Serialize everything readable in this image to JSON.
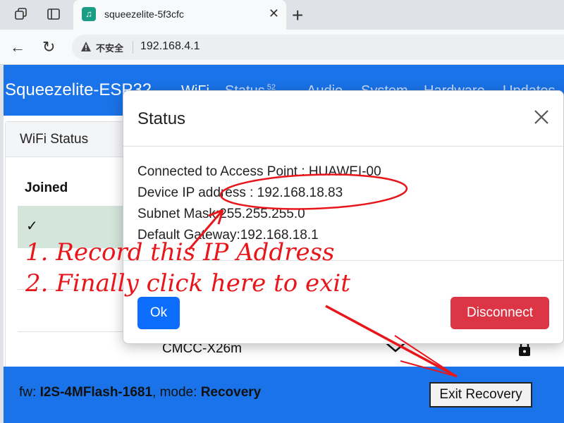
{
  "browser": {
    "tab_title": "squeezelite-5f3cfc",
    "security_label": "不安全",
    "url": "192.168.4.1"
  },
  "navbar": {
    "brand": "Squeezelite-ESP32",
    "links": [
      "WiFi",
      "Status",
      "Audio",
      "System",
      "Hardware",
      "Updates"
    ],
    "status_badge": "52"
  },
  "wifi_card": {
    "title": "WiFi Status",
    "column_joined": "Joined",
    "joined_mark": "✓",
    "ssid_row": "CMCC-X26m"
  },
  "footer": {
    "fw_label": "fw:",
    "fw_value": "I2S-4MFlash-1681",
    "mode_label": ", mode:",
    "mode_value": "Recovery",
    "exit_button": "Exit Recovery"
  },
  "modal": {
    "title": "Status",
    "lines": [
      "Connected to Access Point : HUAWEI-00",
      "Device IP address : 192.168.18.83",
      "Subnet Mask:255.255.255.0",
      "Default Gateway:192.168.18.1"
    ],
    "ok_button": "Ok",
    "disconnect_button": "Disconnect"
  },
  "annotations": {
    "step1": "1. Record this IP Address",
    "step2": "2. Finally click here to exit",
    "color": "#e8161b"
  },
  "colors": {
    "primary": "#1a73e8",
    "danger": "#dc3545",
    "ok": "#0d6efd"
  }
}
